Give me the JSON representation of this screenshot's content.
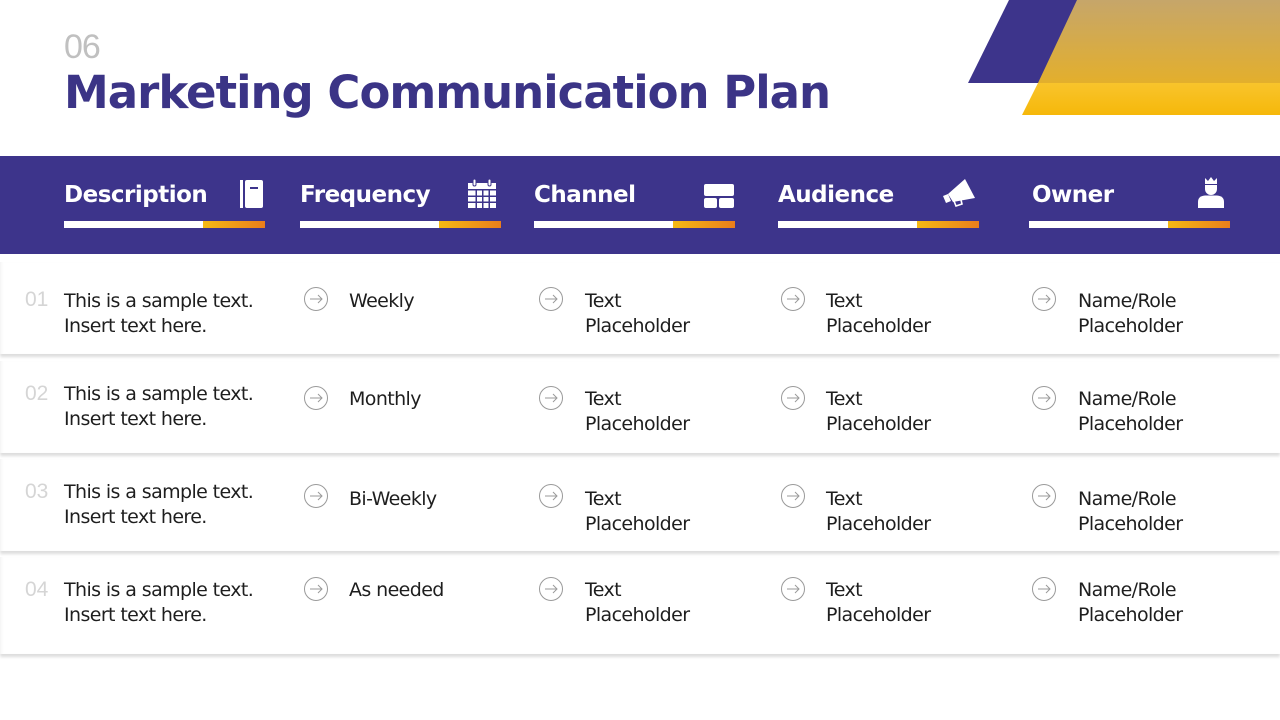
{
  "slide": {
    "number": "06",
    "title": "Marketing Communication Plan"
  },
  "colors": {
    "primary": "#3d348b",
    "accent_yellow": "#f5b914",
    "accent_orange": "#ea7e1c",
    "gold": "#d4a843"
  },
  "header": {
    "columns": [
      {
        "label": "Description",
        "icon": "notebook-icon"
      },
      {
        "label": "Frequency",
        "icon": "calendar-icon"
      },
      {
        "label": "Channel",
        "icon": "layout-icon"
      },
      {
        "label": "Audience",
        "icon": "megaphone-icon"
      },
      {
        "label": "Owner",
        "icon": "person-crown-icon"
      }
    ]
  },
  "rows": [
    {
      "num": "01",
      "desc_l1": "This is a sample text.",
      "desc_l2": "Insert text here.",
      "frequency": "Weekly",
      "channel_l1": "Text",
      "channel_l2": "Placeholder",
      "audience_l1": "Text",
      "audience_l2": "Placeholder",
      "owner_l1": "Name/Role",
      "owner_l2": "Placeholder"
    },
    {
      "num": "02",
      "desc_l1": "This is a sample text.",
      "desc_l2": "Insert text here.",
      "frequency": "Monthly",
      "channel_l1": "Text",
      "channel_l2": "Placeholder",
      "audience_l1": "Text",
      "audience_l2": "Placeholder",
      "owner_l1": "Name/Role",
      "owner_l2": "Placeholder"
    },
    {
      "num": "03",
      "desc_l1": "This is a sample text.",
      "desc_l2": "Insert text here.",
      "frequency": "Bi-Weekly",
      "channel_l1": "Text",
      "channel_l2": "Placeholder",
      "audience_l1": "Text",
      "audience_l2": "Placeholder",
      "owner_l1": "Name/Role",
      "owner_l2": "Placeholder"
    },
    {
      "num": "04",
      "desc_l1": "This is a sample text.",
      "desc_l2": "Insert text here.",
      "frequency": "As needed",
      "channel_l1": "Text",
      "channel_l2": "Placeholder",
      "audience_l1": "Text",
      "audience_l2": "Placeholder",
      "owner_l1": "Name/Role",
      "owner_l2": "Placeholder"
    }
  ]
}
